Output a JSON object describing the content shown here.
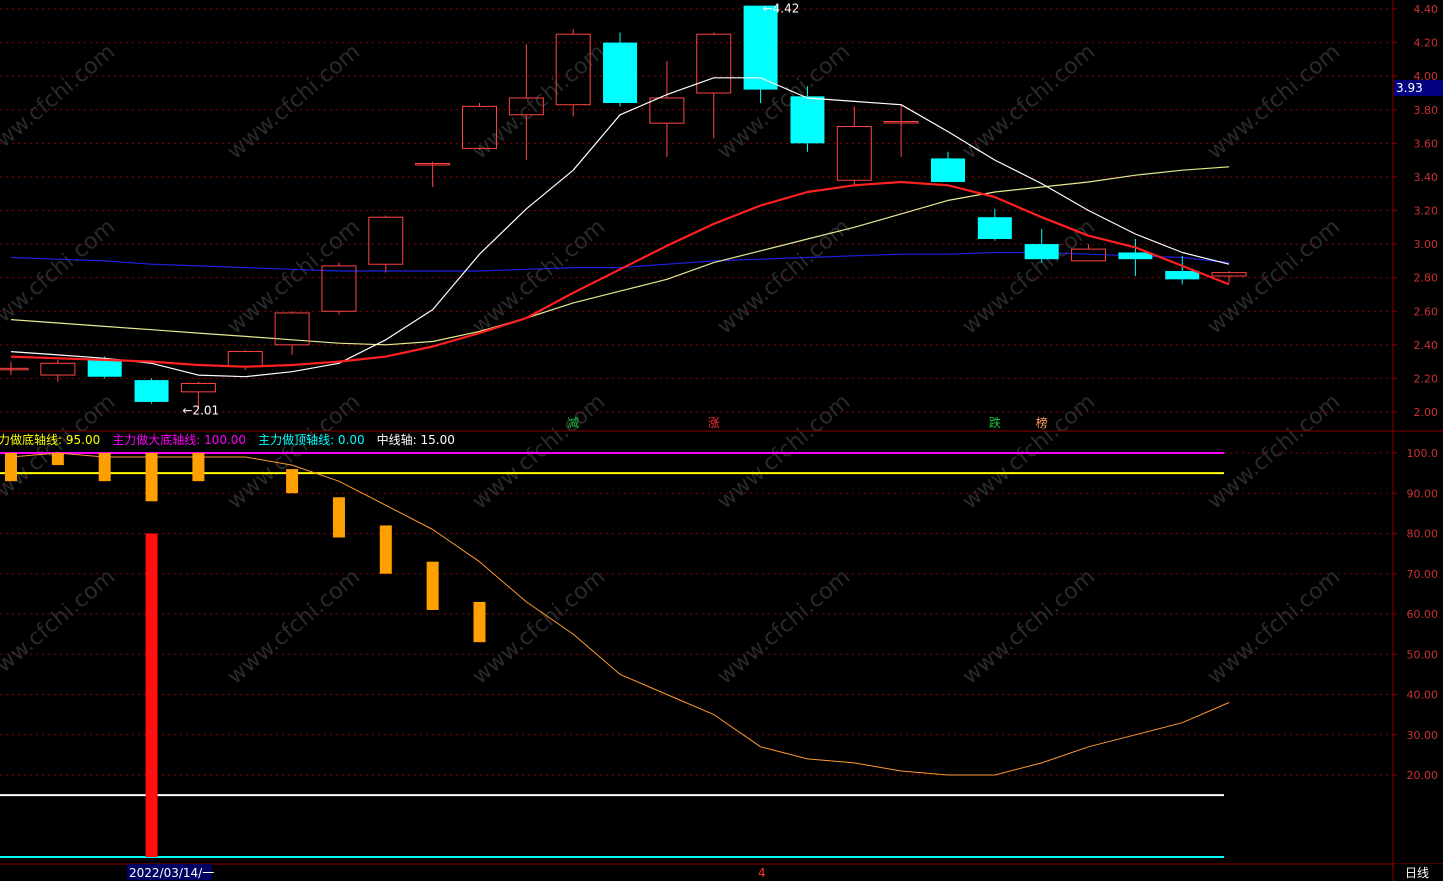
{
  "colors": {
    "background": "#000000",
    "grid": "#8b0000",
    "axis_text": "#c83232",
    "up": "#ff4444",
    "down": "#00ffff",
    "ma_white": "#ffffff",
    "ma_red": "#ff2020",
    "ma_yellow": "#e8e890",
    "ma_blue": "#2020e0",
    "bar_orange": "#ffa000",
    "bar_red": "#ff1010",
    "line_orange": "#ff9933",
    "line_magenta": "#ff00ff",
    "line_yellow": "#ffff00",
    "line_white": "#ffffff",
    "line_cyan": "#00ffff"
  },
  "watermark": "www.cfchi.com",
  "chart_data": [
    {
      "type": "candlestick",
      "y_ticks": [
        "4.40",
        "4.20",
        "4.00",
        "3.80",
        "3.60",
        "3.40",
        "3.20",
        "3.00",
        "2.80",
        "2.60",
        "2.40",
        "2.20",
        "2.00"
      ],
      "ylim": [
        1.95,
        4.45
      ],
      "current_price": "3.93",
      "high_label": "4.42",
      "low_label": "2.01",
      "candles": [
        {
          "o": 2.26,
          "h": 2.3,
          "l": 2.22,
          "c": 2.26
        },
        {
          "o": 2.22,
          "h": 2.31,
          "l": 2.18,
          "c": 2.29
        },
        {
          "o": 2.31,
          "h": 2.33,
          "l": 2.2,
          "c": 2.21
        },
        {
          "o": 2.19,
          "h": 2.2,
          "l": 2.05,
          "c": 2.06
        },
        {
          "o": 2.12,
          "h": 2.18,
          "l": 2.02,
          "c": 2.17
        },
        {
          "o": 2.27,
          "h": 2.37,
          "l": 2.25,
          "c": 2.36
        },
        {
          "o": 2.4,
          "h": 2.6,
          "l": 2.34,
          "c": 2.59
        },
        {
          "o": 2.6,
          "h": 2.89,
          "l": 2.58,
          "c": 2.87
        },
        {
          "o": 2.88,
          "h": 3.17,
          "l": 2.83,
          "c": 3.16
        },
        {
          "o": 3.48,
          "h": 3.49,
          "l": 3.34,
          "c": 3.48
        },
        {
          "o": 3.57,
          "h": 3.84,
          "l": 3.56,
          "c": 3.82
        },
        {
          "o": 3.77,
          "h": 4.19,
          "l": 3.5,
          "c": 3.87
        },
        {
          "o": 3.83,
          "h": 4.28,
          "l": 3.76,
          "c": 4.25
        },
        {
          "o": 4.2,
          "h": 4.26,
          "l": 3.82,
          "c": 3.84
        },
        {
          "o": 3.72,
          "h": 4.09,
          "l": 3.52,
          "c": 3.87
        },
        {
          "o": 3.9,
          "h": 4.26,
          "l": 3.63,
          "c": 4.25
        },
        {
          "o": 4.42,
          "h": 4.42,
          "l": 3.84,
          "c": 3.92
        },
        {
          "o": 3.88,
          "h": 3.94,
          "l": 3.55,
          "c": 3.6
        },
        {
          "o": 3.38,
          "h": 3.82,
          "l": 3.35,
          "c": 3.7
        },
        {
          "o": 3.73,
          "h": 3.83,
          "l": 3.52,
          "c": 3.73
        },
        {
          "o": 3.51,
          "h": 3.55,
          "l": 3.37,
          "c": 3.37
        },
        {
          "o": 3.16,
          "h": 3.21,
          "l": 3.02,
          "c": 3.03
        },
        {
          "o": 3.0,
          "h": 3.09,
          "l": 2.89,
          "c": 2.91
        },
        {
          "o": 2.9,
          "h": 3.0,
          "l": 2.9,
          "c": 2.97
        },
        {
          "o": 2.95,
          "h": 3.03,
          "l": 2.81,
          "c": 2.91
        },
        {
          "o": 2.84,
          "h": 2.93,
          "l": 2.76,
          "c": 2.79
        },
        {
          "o": 2.81,
          "h": 2.84,
          "l": 2.77,
          "c": 2.83
        }
      ],
      "ma_white": [
        2.36,
        2.34,
        2.32,
        2.29,
        2.22,
        2.21,
        2.24,
        2.29,
        2.43,
        2.61,
        2.94,
        3.21,
        3.44,
        3.77,
        3.89,
        3.99,
        3.99,
        3.87,
        3.85,
        3.83,
        3.67,
        3.5,
        3.36,
        3.2,
        3.06,
        2.95,
        2.88
      ],
      "ma_red": [
        2.33,
        2.32,
        2.31,
        2.3,
        2.28,
        2.27,
        2.28,
        2.3,
        2.33,
        2.39,
        2.47,
        2.56,
        2.71,
        2.85,
        2.99,
        3.12,
        3.23,
        3.31,
        3.35,
        3.37,
        3.35,
        3.28,
        3.16,
        3.05,
        2.98,
        2.87,
        2.76
      ],
      "ma_yellow": [
        2.55,
        2.53,
        2.51,
        2.49,
        2.47,
        2.45,
        2.43,
        2.41,
        2.4,
        2.42,
        2.48,
        2.56,
        2.65,
        2.72,
        2.79,
        2.89,
        2.96,
        3.03,
        3.1,
        3.18,
        3.26,
        3.31,
        3.34,
        3.37,
        3.41,
        3.44,
        3.46
      ],
      "ma_blue": [
        2.92,
        2.91,
        2.9,
        2.88,
        2.87,
        2.86,
        2.85,
        2.84,
        2.84,
        2.84,
        2.84,
        2.85,
        2.86,
        2.86,
        2.88,
        2.9,
        2.91,
        2.92,
        2.93,
        2.94,
        2.94,
        2.95,
        2.95,
        2.94,
        2.93,
        2.92,
        2.89
      ],
      "markers": [
        {
          "index": 12,
          "text": "减",
          "color": "#20c040"
        },
        {
          "index": 15,
          "text": "涨",
          "color": "#ff3030"
        },
        {
          "index": 21,
          "text": "跌",
          "color": "#20c040"
        },
        {
          "index": 22,
          "text": "榜",
          "color": "#ffa060"
        }
      ]
    },
    {
      "type": "indicator",
      "legend": [
        {
          "text": "力做底轴线: ",
          "value": "95.00",
          "color": "#ffff00"
        },
        {
          "text": "主力做大底轴线: ",
          "value": "100.00",
          "color": "#ff00ff"
        },
        {
          "text": "主力做顶轴线: ",
          "value": "0.00",
          "color": "#00ffff"
        },
        {
          "text": "中线轴: ",
          "value": "15.00",
          "color": "#ffffff"
        }
      ],
      "y_ticks": [
        "100.0",
        "90.00",
        "80.00",
        "70.00",
        "60.00",
        "50.00",
        "40.00",
        "30.00",
        "20.00"
      ],
      "ylim": [
        0,
        103
      ],
      "lines": {
        "bottom_axis": 95,
        "big_bottom_axis": 100,
        "top_axis": 0,
        "mid_axis": 15
      },
      "orange_bars": [
        {
          "index": 0,
          "top": 100,
          "bottom": 93
        },
        {
          "index": 1,
          "top": 100,
          "bottom": 97
        },
        {
          "index": 2,
          "top": 100,
          "bottom": 93
        },
        {
          "index": 3,
          "top": 100,
          "bottom": 88
        },
        {
          "index": 4,
          "top": 100,
          "bottom": 93
        },
        {
          "index": 6,
          "top": 96,
          "bottom": 90
        },
        {
          "index": 7,
          "top": 89,
          "bottom": 79
        },
        {
          "index": 8,
          "top": 82,
          "bottom": 70
        },
        {
          "index": 9,
          "top": 73,
          "bottom": 61
        },
        {
          "index": 10,
          "top": 63,
          "bottom": 53
        }
      ],
      "red_bar": {
        "index": 3,
        "top": 80,
        "bottom": 0
      },
      "orange_line": [
        99,
        100,
        99,
        99,
        99,
        99,
        97,
        93,
        87,
        81,
        73,
        63,
        55,
        45,
        40,
        35,
        27,
        24,
        23,
        21,
        20,
        20,
        23,
        27,
        30,
        33,
        38
      ]
    }
  ],
  "footer": {
    "date_label": "2022/03/14/一",
    "cursor_label": "4",
    "period_label": "日线"
  }
}
